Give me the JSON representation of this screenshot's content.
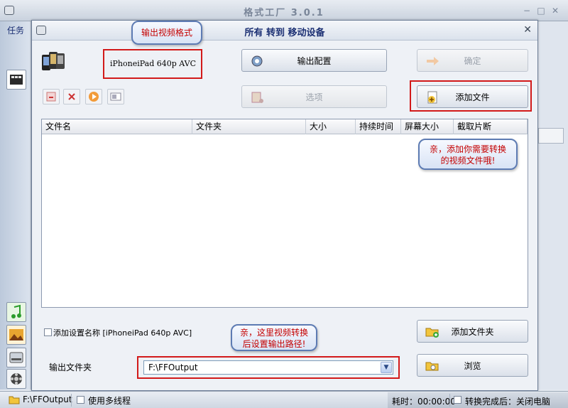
{
  "main_window": {
    "title": "格式工厂 3.0.1",
    "left_label": "任务"
  },
  "dialog": {
    "title": "所有 转到 移动设备",
    "format_text": "iPhoneiPad 640p AVC",
    "bubble_format": "输出视频格式",
    "buttons": {
      "output_config": "输出配置",
      "ok": "确定",
      "options": "选项",
      "add_file": "添加文件",
      "add_folder": "添加文件夹",
      "browse": "浏览"
    },
    "table_headers": [
      "文件名",
      "文件夹",
      "大小",
      "持续时间",
      "屏幕大小",
      "截取片断"
    ],
    "bubble_add_file": [
      "亲，添加你需要转换",
      "的视频文件哦!"
    ],
    "bubble_output": [
      "亲，这里视频转换",
      "后设置输出路径!"
    ],
    "add_setting_name_label": "添加设置名称 [iPhoneiPad 640p AVC]",
    "output_folder_label": "输出文件夹",
    "output_folder_value": "F:\\FFOutput"
  },
  "status_bar": {
    "path": "F:\\FFOutput",
    "multithread_label": "使用多线程",
    "elapsed": "耗时：00:00:00",
    "after_done": "转换完成后：关闭电脑"
  },
  "colors": {
    "accent_title": "#1b2f73",
    "highlight_box": "#d21a1a",
    "bubble_text": "#c40000"
  }
}
